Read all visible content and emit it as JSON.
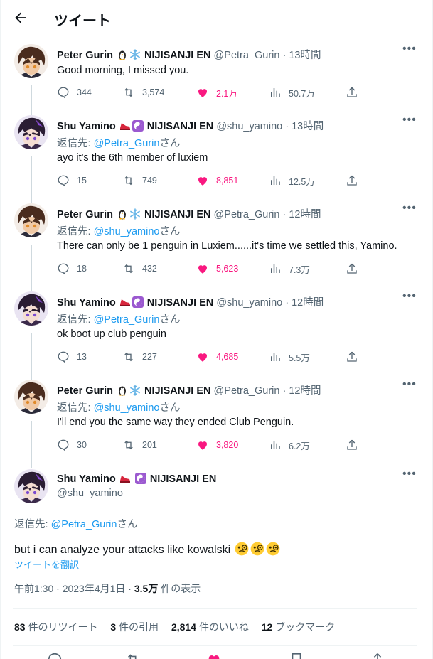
{
  "header": {
    "title": "ツイート"
  },
  "tweets": [
    {
      "name": "Peter Gurin",
      "org": "NIJISANJI EN",
      "handle": "@Petra_Gurin",
      "time": "13時間",
      "reply_prefix": "",
      "reply_handle": "",
      "reply_suffix": "",
      "text": "Good morning, I missed you.",
      "replies": "344",
      "retweets": "3,574",
      "likes": "2.1万",
      "views": "50.7万"
    },
    {
      "name": "Shu Yamino",
      "org": "NIJISANJI EN",
      "handle": "@shu_yamino",
      "time": "13時間",
      "reply_prefix": "返信先: ",
      "reply_handle": "@Petra_Gurin",
      "reply_suffix": "さん",
      "text": "ayo it's the 6th member of luxiem",
      "replies": "15",
      "retweets": "749",
      "likes": "8,851",
      "views": "12.5万"
    },
    {
      "name": "Peter Gurin",
      "org": "NIJISANJI EN",
      "handle": "@Petra_Gurin",
      "time": "12時間",
      "reply_prefix": "返信先: ",
      "reply_handle": "@shu_yamino",
      "reply_suffix": "さん",
      "text": "There can only be 1 penguin in Luxiem......it's time we settled this, Yamino.",
      "replies": "18",
      "retweets": "432",
      "likes": "5,623",
      "views": "7.3万"
    },
    {
      "name": "Shu Yamino",
      "org": "NIJISANJI EN",
      "handle": "@shu_yamino",
      "time": "12時間",
      "reply_prefix": "返信先: ",
      "reply_handle": "@Petra_Gurin",
      "reply_suffix": "さん",
      "text": "ok boot up club penguin",
      "replies": "13",
      "retweets": "227",
      "likes": "4,685",
      "views": "5.5万"
    },
    {
      "name": "Peter Gurin",
      "org": "NIJISANJI EN",
      "handle": "@Petra_Gurin",
      "time": "12時間",
      "reply_prefix": "返信先: ",
      "reply_handle": "@shu_yamino",
      "reply_suffix": "さん",
      "text": "I'll end you the same way they ended Club Penguin.",
      "replies": "30",
      "retweets": "201",
      "likes": "3,820",
      "views": "6.2万"
    }
  ],
  "main_tweet": {
    "name": "Shu Yamino",
    "org": "NIJISANJI EN",
    "handle": "@shu_yamino",
    "reply_prefix": "返信先: ",
    "reply_handle": "@Petra_Gurin",
    "reply_suffix": "さん",
    "text": "but i can analyze your attacks like kowalski",
    "translate": "ツイートを翻訳",
    "date": "午前1:30 · 2023年4月1日 · ",
    "views_count": "3.5万",
    "views_label": " 件の表示",
    "stats": {
      "retweets_count": "83",
      "retweets_label": " 件のリツイート",
      "quotes_count": "3",
      "quotes_label": " 件の引用",
      "likes_count": "2,814",
      "likes_label": " 件のいいね",
      "bookmarks_count": "12",
      "bookmarks_label": " ブックマーク"
    }
  },
  "colors": {
    "accent": "#1d9bf0",
    "like": "#f91880",
    "muted": "#536471"
  },
  "icons": [
    "back-arrow-icon",
    "penguin-icon",
    "snowflake-icon",
    "red-sneaker-icon",
    "yin-yang-icon",
    "more-icon",
    "reply-icon",
    "retweet-icon",
    "heart-icon",
    "views-icon",
    "share-icon",
    "monocle-face-icon",
    "bookmark-icon"
  ]
}
